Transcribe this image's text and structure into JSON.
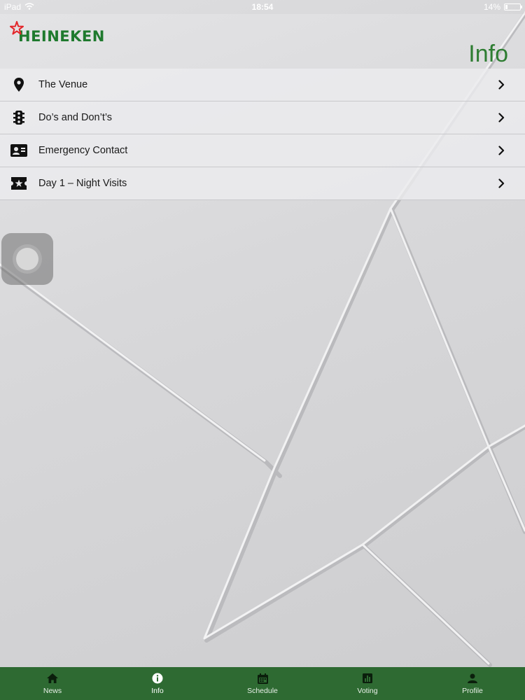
{
  "status_bar": {
    "device": "iPad",
    "time": "18:54",
    "battery": "14%"
  },
  "header": {
    "brand": "HEINEKEN",
    "title": "Info"
  },
  "menu": {
    "items": [
      {
        "label": "The Venue",
        "icon": "map-pin-icon"
      },
      {
        "label": "Do’s and Don’t’s",
        "icon": "traffic-light-icon"
      },
      {
        "label": "Emergency Contact",
        "icon": "contact-card-icon"
      },
      {
        "label": "Day 1 – Night Visits",
        "icon": "ticket-star-icon"
      }
    ]
  },
  "tab_bar": {
    "tabs": [
      {
        "label": "News",
        "icon": "home-icon"
      },
      {
        "label": "Info",
        "icon": "info-icon",
        "active": true
      },
      {
        "label": "Schedule",
        "icon": "calendar-icon"
      },
      {
        "label": "Voting",
        "icon": "bar-chart-icon"
      },
      {
        "label": "Profile",
        "icon": "user-icon"
      }
    ]
  },
  "colors": {
    "brand_green": "#2e7d32",
    "tab_bar_bg": "#2e6a32",
    "logo_star_red": "#e3262a"
  }
}
